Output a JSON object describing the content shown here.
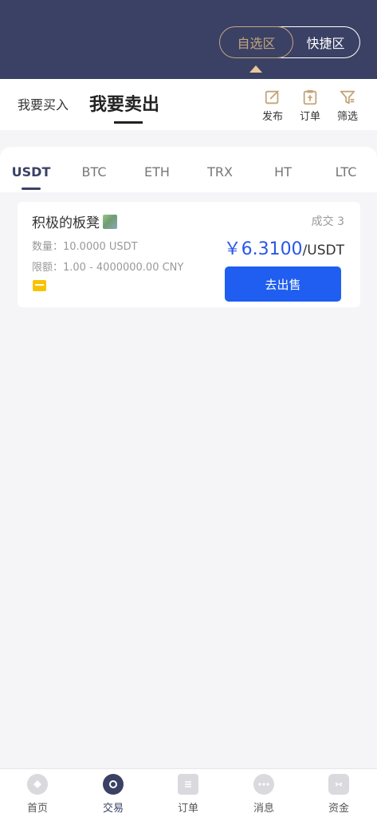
{
  "header": {
    "segment_left": "自选区",
    "segment_right": "快捷区"
  },
  "trade_tabs": {
    "buy": "我要买入",
    "sell": "我要卖出"
  },
  "actions": [
    {
      "label": "发布",
      "icon": "edit-icon"
    },
    {
      "label": "订单",
      "icon": "clipboard-icon"
    },
    {
      "label": "筛选",
      "icon": "filter-icon"
    }
  ],
  "coins": [
    "USDT",
    "BTC",
    "ETH",
    "TRX",
    "HT",
    "LTC"
  ],
  "active_coin": "USDT",
  "listing": {
    "seller": "积极的板凳",
    "deals": "成交 3",
    "quantity": "数量：10.0000 USDT",
    "limit": "限额：1.00 - 4000000.00 CNY",
    "price": "￥6.3100",
    "price_unit": "/USDT",
    "button": "去出售"
  },
  "bottom_nav": [
    {
      "label": "首页",
      "icon": "home-icon"
    },
    {
      "label": "交易",
      "icon": "trade-icon"
    },
    {
      "label": "订单",
      "icon": "orders-icon"
    },
    {
      "label": "消息",
      "icon": "message-icon"
    },
    {
      "label": "资金",
      "icon": "wallet-icon"
    }
  ],
  "colors": {
    "header_bg": "#3b4165",
    "accent_gold": "#c3a57c",
    "primary_blue": "#1f5ef0",
    "price_blue": "#2a57e8"
  }
}
